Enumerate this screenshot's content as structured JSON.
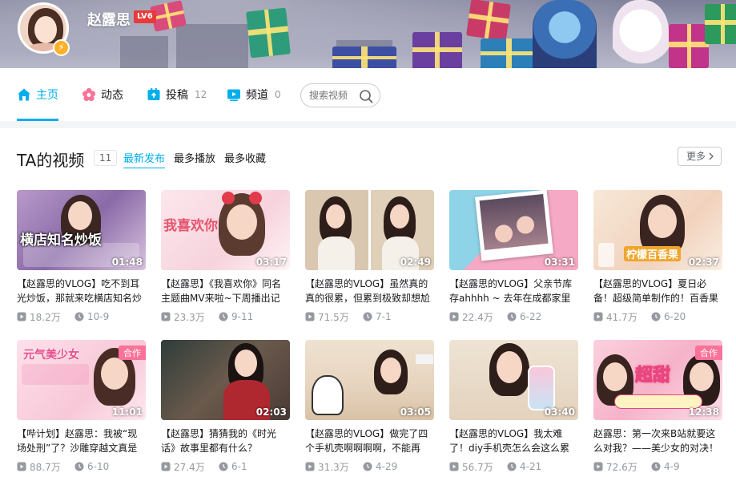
{
  "user": {
    "name": "赵露思",
    "level": "LV6",
    "badge_icon": "lightning-icon"
  },
  "nav": {
    "tabs": [
      {
        "label": "主页",
        "count": "",
        "icon": "home-icon"
      },
      {
        "label": "动态",
        "count": "",
        "icon": "flower-icon"
      },
      {
        "label": "投稿",
        "count": "12",
        "icon": "upload-icon"
      },
      {
        "label": "频道",
        "count": "0",
        "icon": "channel-icon"
      }
    ],
    "search_placeholder": "搜索视频"
  },
  "section": {
    "title": "TA的视频",
    "count": "11",
    "sorts": [
      "最新发布",
      "最多播放",
      "最多收藏"
    ],
    "more_label": "更多"
  },
  "colors": {
    "accent": "#00aeec",
    "pink": "#fb7299",
    "muted": "#9499a0"
  },
  "videos": [
    {
      "title": "【赵露思的VLOG】吃不到耳光炒饭，那就来吃横店知名炒",
      "duration": "01:48",
      "views": "18.2万",
      "date": "10-9",
      "tag": "",
      "overlay": "横店知名炒饭"
    },
    {
      "title": "【赵露思】《我喜欢你》同名主题曲MV来啦~下周播出记",
      "duration": "03:17",
      "views": "23.3万",
      "date": "9-11",
      "tag": "",
      "overlay": "我喜欢你"
    },
    {
      "title": "【赵露思的VLOG】虽然真的真的很累，但累到极致却想尬",
      "duration": "02:49",
      "views": "71.5万",
      "date": "7-1",
      "tag": "",
      "overlay": ""
    },
    {
      "title": "【赵露思的VLOG】父亲节库存ahhhh ~ 去年在成都家里的",
      "duration": "03:31",
      "views": "22.4万",
      "date": "6-22",
      "tag": "",
      "overlay": ""
    },
    {
      "title": "【赵露思的VLOG】夏日必备！超级简单制作的！百香果",
      "duration": "02:37",
      "views": "41.7万",
      "date": "6-20",
      "tag": "",
      "overlay": "柠檬百香果"
    },
    {
      "title": "【哔计划】赵露思：我被“现场处刑”了？沙雕穿越文真是",
      "duration": "11:01",
      "views": "88.7万",
      "date": "6-10",
      "tag": "合作",
      "overlay": "元气美少女"
    },
    {
      "title": "【赵露思】猜猜我的《时光话》故事里都有什么？",
      "duration": "02:03",
      "views": "27.4万",
      "date": "6-1",
      "tag": "",
      "overlay": ""
    },
    {
      "title": "【赵露思的VLOG】做完了四个手机壳啊啊啊啊，不能再",
      "duration": "03:05",
      "views": "31.3万",
      "date": "4-29",
      "tag": "",
      "overlay": ""
    },
    {
      "title": "【赵露思的VLOG】我太难了！diy手机壳怎么会这么累",
      "duration": "03:40",
      "views": "56.7万",
      "date": "4-21",
      "tag": "",
      "overlay": ""
    },
    {
      "title": "赵露思：第一次来B站就要这么对我？——美少女的对决！",
      "duration": "12:38",
      "views": "72.6万",
      "date": "4-9",
      "tag": "合作",
      "overlay": "超甜"
    }
  ]
}
